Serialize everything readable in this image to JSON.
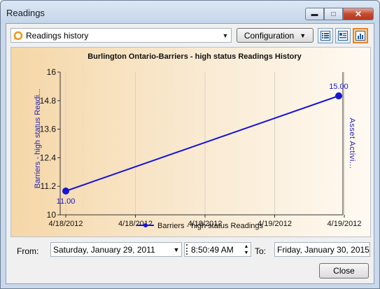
{
  "window": {
    "title": "Readings"
  },
  "toolbar": {
    "history_combo": {
      "selected": "Readings history",
      "icon": "history-icon"
    },
    "configuration_label": "Configuration",
    "view_buttons": [
      {
        "icon": "list-view-icon",
        "active": false
      },
      {
        "icon": "detail-view-icon",
        "active": false
      },
      {
        "icon": "chart-view-icon",
        "active": true
      }
    ]
  },
  "chart_data": {
    "type": "line",
    "title": "Burlington Ontario-Barriers - high status Readings History",
    "ylabel": "Barriers - high status Readi...",
    "y2label": "Asset Activi...",
    "ylim": [
      10,
      16
    ],
    "yticks": [
      "16",
      "14.8",
      "13.6",
      "12.4",
      "11.2",
      "10"
    ],
    "xticks": [
      "4/18/2012",
      "4/18/2012",
      "4/18/2012",
      "4/19/2012",
      "4/19/2012"
    ],
    "legend": "bottom",
    "series": [
      {
        "name": "Barriers - high status Readings",
        "color": "#1515d6",
        "points": [
          {
            "x": 0.0,
            "y": 11.0,
            "label": "11.00"
          },
          {
            "x": 1.0,
            "y": 15.0,
            "label": "15.00"
          }
        ]
      }
    ],
    "grid": true
  },
  "range": {
    "from_label": "From:",
    "from_date": "Saturday, January 29, 2011",
    "from_time": "8:50:49 AM",
    "to_label": "To:",
    "to_date": "Friday, January 30, 2015"
  },
  "footer": {
    "close_label": "Close"
  },
  "colors": {
    "line": "#1515d6",
    "close_btn": "#c44a2f",
    "active_view": "#e8862a"
  }
}
